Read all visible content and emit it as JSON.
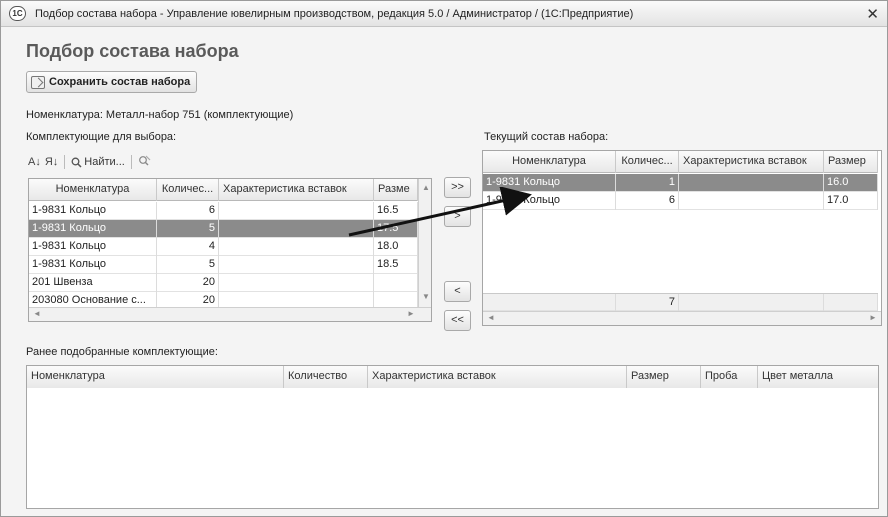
{
  "window": {
    "app_icon": "1С",
    "title": "Подбор состава набора - Управление ювелирным производством, редакция 5.0 / Администратор / (1С:Предприятие)",
    "close_glyph": "✕"
  },
  "form": {
    "title": "Подбор состава набора",
    "save_button": "Сохранить состав набора",
    "nomenclature_line": "Номенклатура: Металл-набор 751 (комплектующие)"
  },
  "left": {
    "label": "Комплектующие для выбора:",
    "toolbar": {
      "sort_asc": "A↓",
      "sort_desc": "Я↓",
      "find": "Найти...",
      "find_icon": "search-icon",
      "clear_icon": "clear-search-icon"
    },
    "columns": [
      "Номенклатура",
      "Количес...",
      "Характеристика вставок",
      "Разме"
    ],
    "rows": [
      {
        "nom": "1-9831 Кольцо",
        "qty": "6",
        "char": "",
        "size": "16.5"
      },
      {
        "nom": "1-9831 Кольцо",
        "qty": "5",
        "char": "",
        "size": "17.5"
      },
      {
        "nom": "1-9831 Кольцо",
        "qty": "4",
        "char": "",
        "size": "18.0"
      },
      {
        "nom": "1-9831 Кольцо",
        "qty": "5",
        "char": "",
        "size": "18.5"
      },
      {
        "nom": "201 Швенза",
        "qty": "20",
        "char": "",
        "size": ""
      },
      {
        "nom": "203080 Основание с...",
        "qty": "20",
        "char": "",
        "size": ""
      }
    ],
    "selected_row": 1
  },
  "middle": {
    "add_all": ">>",
    "add": ">",
    "remove": "<",
    "remove_all": "<<"
  },
  "right": {
    "label": "Текущий состав набора:",
    "columns": [
      "Номенклатура",
      "Количес...",
      "Характеристика вставок",
      "Размер"
    ],
    "rows": [
      {
        "nom": "1-9831 Кольцо",
        "qty": "1",
        "char": "",
        "size": "16.0"
      },
      {
        "nom": "1-9831 Кольцо",
        "qty": "6",
        "char": "",
        "size": "17.0"
      }
    ],
    "total_qty": "7",
    "selected_row": 0
  },
  "bottom": {
    "label": "Ранее подобранные комплектующие:",
    "columns": [
      "Номенклатура",
      "Количество",
      "Характеристика вставок",
      "Размер",
      "Проба",
      "Цвет металла"
    ]
  }
}
